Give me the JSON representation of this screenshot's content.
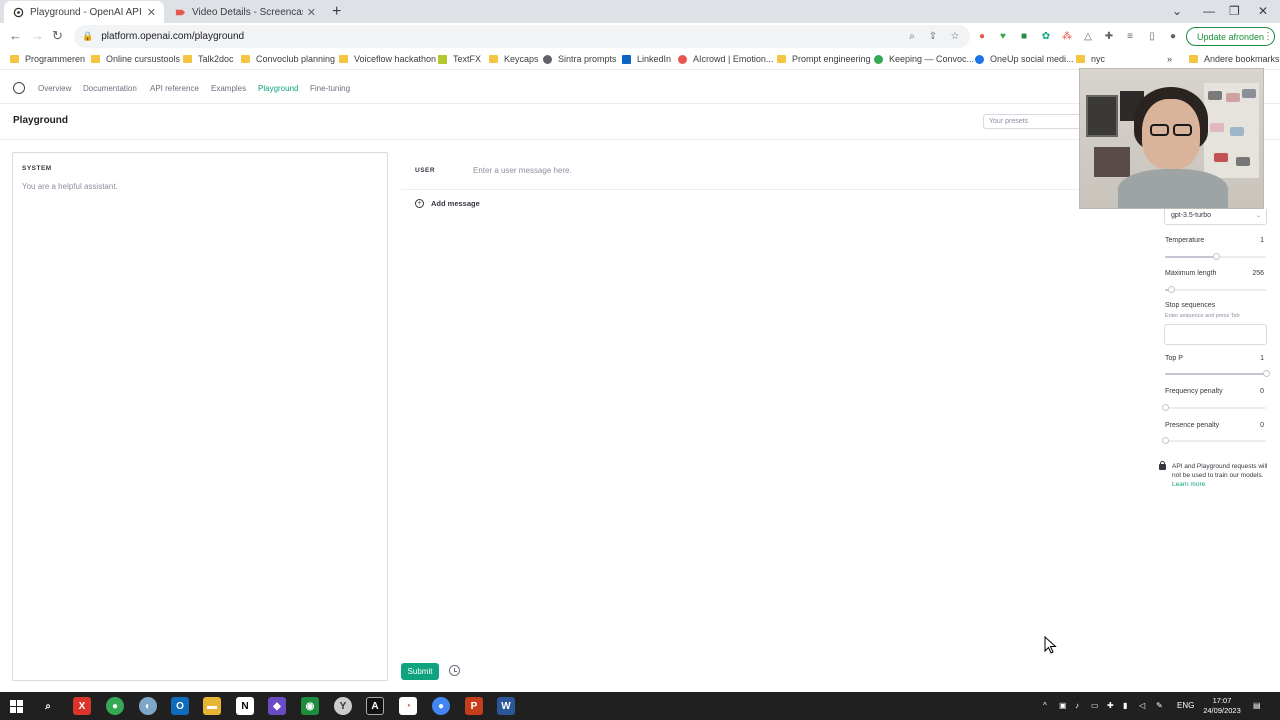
{
  "browser": {
    "tabs": [
      {
        "title": "Playground - OpenAI API",
        "icon": "openai-icon",
        "active": true
      },
      {
        "title": "Video Details - Screencastify",
        "icon": "screencastify-icon",
        "active": false
      }
    ],
    "url": "platform.openai.com/playground",
    "update_label": "Update afronden",
    "bookmarks": [
      "Programmeren",
      "Online cursustools",
      "Talk2doc",
      "Convoclub planning",
      "Voiceflow hackathon",
      "TextFX",
      "Keycaps",
      "Sintra prompts",
      "LinkedIn",
      "AIcrowd | Emotion...",
      "Prompt engineering",
      "Keeping — Convoc...",
      "OneUp social medi...",
      "nyc"
    ],
    "bookmarks_overflow": "»",
    "other_bookmarks": "Andere bookmarks"
  },
  "nav": {
    "links": [
      "Overview",
      "Documentation",
      "API reference",
      "Examples",
      "Playground",
      "Fine-tuning"
    ],
    "active": "Playground"
  },
  "page": {
    "title": "Playground",
    "presets_placeholder": "Your presets"
  },
  "system": {
    "label": "SYSTEM",
    "placeholder": "You are a helpful assistant."
  },
  "chat": {
    "user_label": "USER",
    "user_placeholder": "Enter a user message here.",
    "add_message": "Add message",
    "submit": "Submit"
  },
  "settings": {
    "model": "gpt-3.5-turbo",
    "temperature": {
      "label": "Temperature",
      "value": "1",
      "fraction": 0.5
    },
    "max_length": {
      "label": "Maximum length",
      "value": "256",
      "fraction": 0.06
    },
    "stop_sequences": {
      "label": "Stop sequences",
      "hint": "Enter sequence and press Tab"
    },
    "top_p": {
      "label": "Top P",
      "value": "1",
      "fraction": 1.0
    },
    "frequency_penalty": {
      "label": "Frequency penalty",
      "value": "0",
      "fraction": 0.0
    },
    "presence_penalty": {
      "label": "Presence penalty",
      "value": "0",
      "fraction": 0.0
    },
    "privacy_text": "API and Playground requests will not be used to train our models.",
    "privacy_link": "Learn more"
  },
  "taskbar": {
    "language": "ENG",
    "time": "17:07",
    "date": "24/09/2023"
  },
  "colors": {
    "accent": "#10a37f",
    "taskbar": "#202020"
  }
}
